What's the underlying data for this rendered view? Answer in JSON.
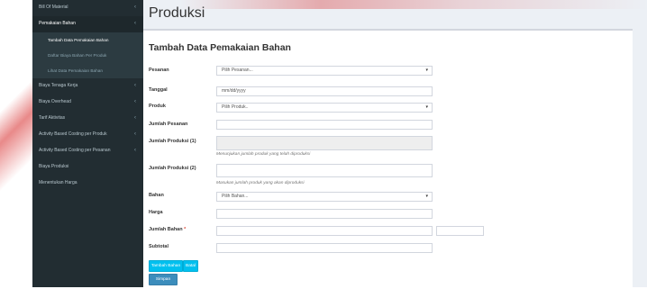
{
  "sidebar": {
    "items": [
      {
        "label": "Bill Of Material",
        "chevron": "‹"
      },
      {
        "label": "Pemakaian Bahan",
        "chevron": "‹"
      },
      {
        "label": "Tambah Data Pemakaian Bahan"
      },
      {
        "label": "Daftar Biaya Bahan Per Produk"
      },
      {
        "label": "Lihat Data Pemakaian Bahan"
      },
      {
        "label": "Biaya Tenaga Kerja",
        "chevron": "‹"
      },
      {
        "label": "Biaya Overhead",
        "chevron": "‹"
      },
      {
        "label": "Tarif Aktivitas",
        "chevron": "‹"
      },
      {
        "label": "Activity Based Costing per Produk",
        "chevron": "‹"
      },
      {
        "label": "Activity Based Costing per Pesanan",
        "chevron": "‹"
      },
      {
        "label": "Biaya Produksi"
      },
      {
        "label": "Menentukan Harga"
      }
    ]
  },
  "page": {
    "title": "Produksi",
    "form_title": "Tambah Data Pemakaian Bahan"
  },
  "form": {
    "pesanan": {
      "label": "Pesanan",
      "value": "Pilih Pesanan..."
    },
    "tanggal": {
      "label": "Tanggal",
      "value": "mm/dd/yyyy"
    },
    "produk": {
      "label": "Produk",
      "value": "Pilih Produk.."
    },
    "jumlah_pesanan": {
      "label": "Jumlah Pesanan",
      "value": ""
    },
    "jumlah_produksi_1": {
      "label": "Jumlah Produksi (1)",
      "value": "",
      "help": "Menunjukan jumlah produk yang telah diproduksi"
    },
    "jumlah_produksi_2": {
      "label": "Jumlah Produksi (2)",
      "value": "",
      "help": "Masukan jumlah produk yang akan diproduksi"
    },
    "bahan": {
      "label": "Bahan",
      "value": "Pilih Bahan..."
    },
    "harga": {
      "label": "Harga",
      "value": ""
    },
    "jumlah_bahan": {
      "label": "Jumlah Bahan",
      "required": "*",
      "value": "",
      "unit_value": ""
    },
    "subtotal": {
      "label": "Subtotal",
      "value": ""
    }
  },
  "buttons": {
    "tambah_bahan": "Tambah Bahan",
    "batal": "Batal",
    "simpan": "Simpan"
  },
  "icons": {
    "dropdown": "▾"
  },
  "colors": {
    "sidebar_bg": "#222d32",
    "info": "#00c0ef",
    "primary": "#3c8dbc",
    "required": "#dd4b39"
  }
}
